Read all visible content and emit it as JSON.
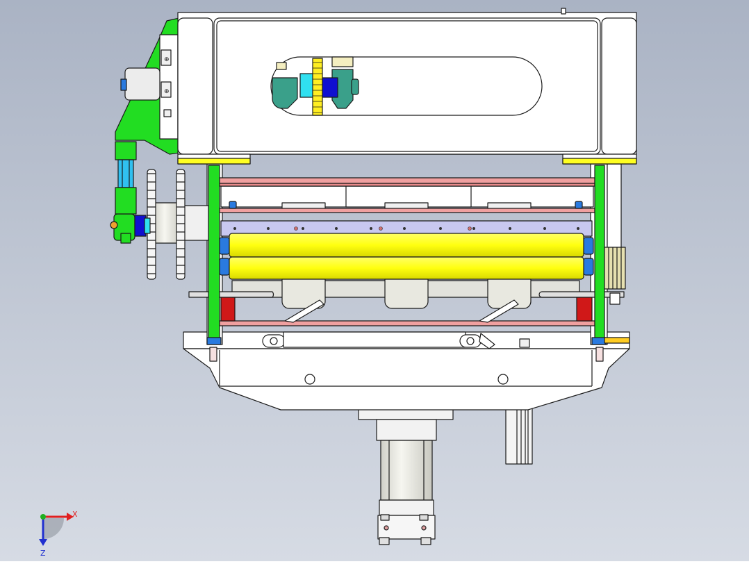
{
  "viewport": {
    "background_top": "#aab3c4",
    "background_bottom": "#d6dbe4"
  },
  "triad": {
    "x_label": "X",
    "z_label": "Z",
    "x_color": "#e02020",
    "z_color": "#2030d0",
    "y_color": "#20b020"
  },
  "colors": {
    "body": "#ffffff",
    "outline": "#1a1a1a",
    "green_plate": "#22dd22",
    "yellow_roller": "#ffff22",
    "red_block": "#d01818",
    "pink_rod": "#f0a0a0",
    "blue_bearing": "#2a7adf",
    "cyan_shaft": "#30e0f0",
    "lavender_bar": "#c8c8f0",
    "cream_part": "#f4eec0",
    "gray_cylinder": "#e4e4dc",
    "navy_hub": "#1010d0"
  }
}
